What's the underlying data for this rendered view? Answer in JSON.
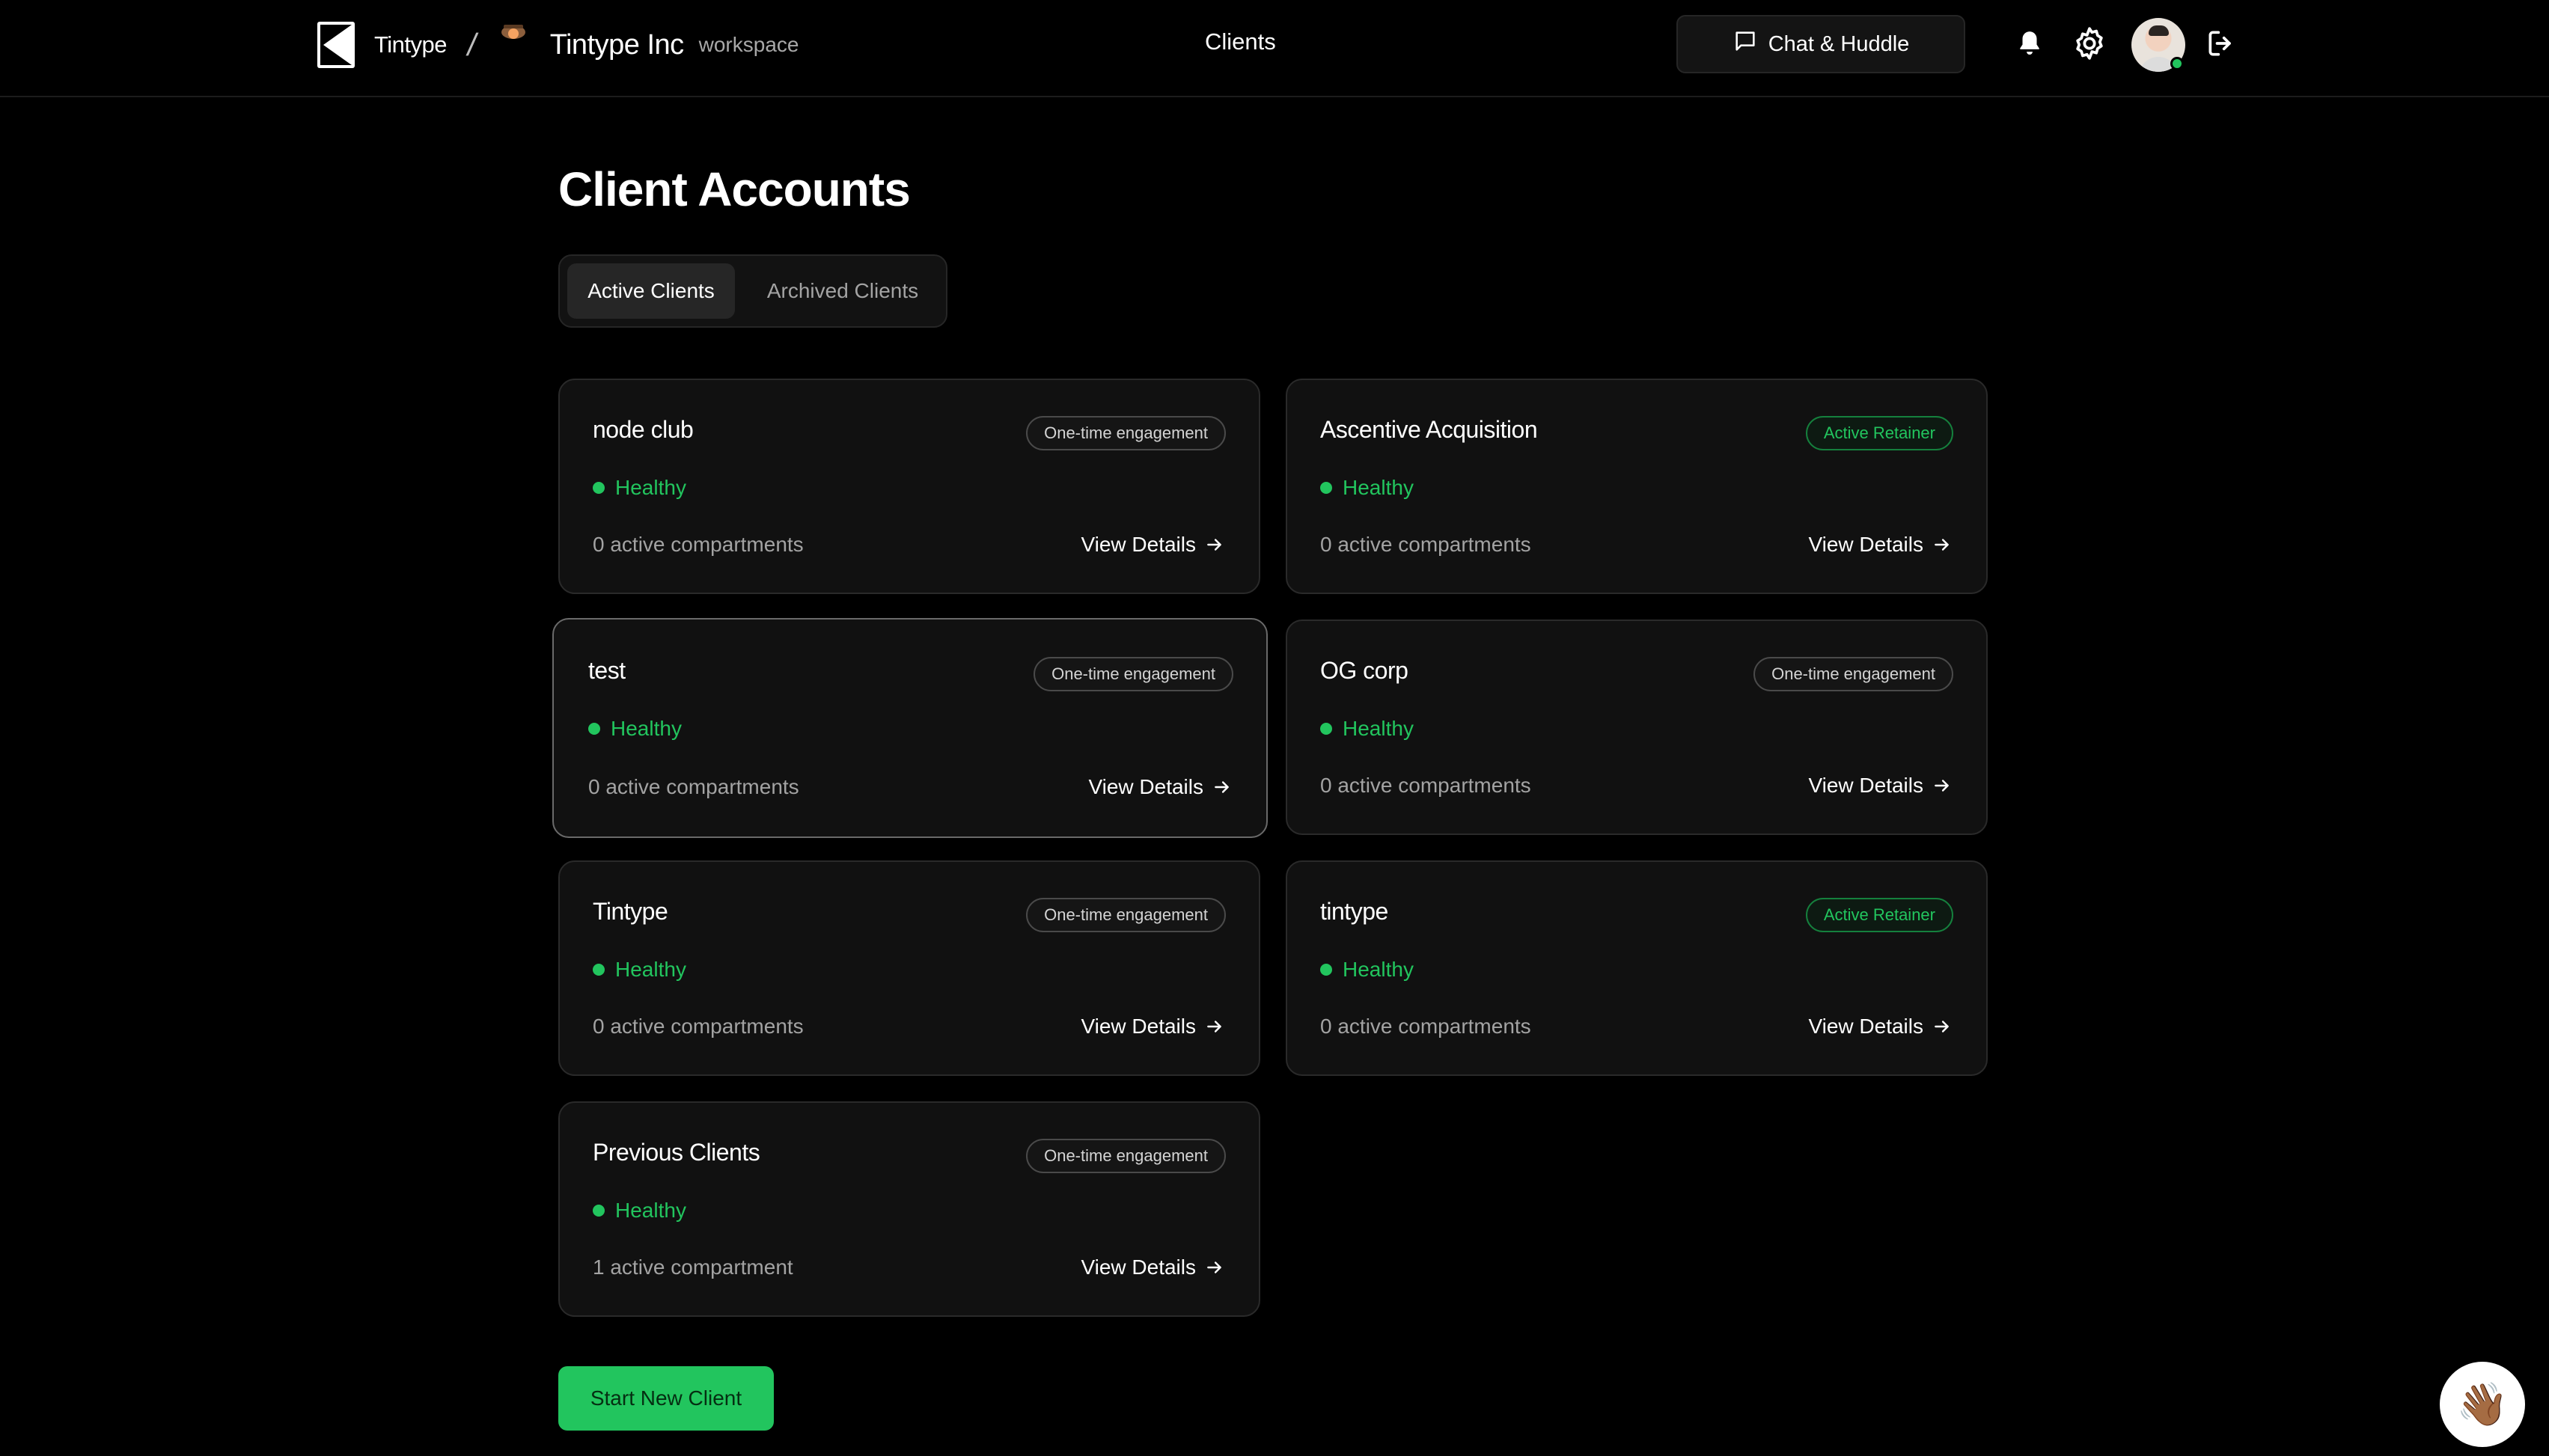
{
  "header": {
    "brand": "Tintype",
    "separator": "/",
    "workspace_name": "Tintype Inc",
    "workspace_label": "workspace",
    "nav_item": "Clients",
    "chat_button": "Chat & Huddle"
  },
  "main": {
    "title": "Client Accounts",
    "tabs": [
      {
        "label": "Active Clients",
        "active": true
      },
      {
        "label": "Archived Clients",
        "active": false
      }
    ],
    "cards": [
      {
        "name": "node club",
        "badge": "One-time engagement",
        "status": "Healthy",
        "compartments": "0 active compartments",
        "action": "View Details"
      },
      {
        "name": "Ascentive Acquisition",
        "badge": "Active Retainer",
        "status": "Healthy",
        "compartments": "0 active compartments",
        "action": "View Details"
      },
      {
        "name": "test",
        "badge": "One-time engagement",
        "status": "Healthy",
        "compartments": "0 active compartments",
        "action": "View Details"
      },
      {
        "name": "OG corp",
        "badge": "One-time engagement",
        "status": "Healthy",
        "compartments": "0 active compartments",
        "action": "View Details"
      },
      {
        "name": "Tintype",
        "badge": "One-time engagement",
        "status": "Healthy",
        "compartments": "0 active compartments",
        "action": "View Details"
      },
      {
        "name": "tintype",
        "badge": "Active Retainer",
        "status": "Healthy",
        "compartments": "0 active compartments",
        "action": "View Details"
      },
      {
        "name": "Previous Clients",
        "badge": "One-time engagement",
        "status": "Healthy",
        "compartments": "1 active compartment",
        "action": "View Details"
      }
    ],
    "start_button": "Start New Client"
  },
  "colors": {
    "background": "#000000",
    "card": "#111111",
    "accent_green": "#22c55e"
  },
  "icons": [
    "logo-icon",
    "chat-icon",
    "bell-icon",
    "gear-icon",
    "logout-icon",
    "arrow-right-icon",
    "wave-hand-icon"
  ]
}
